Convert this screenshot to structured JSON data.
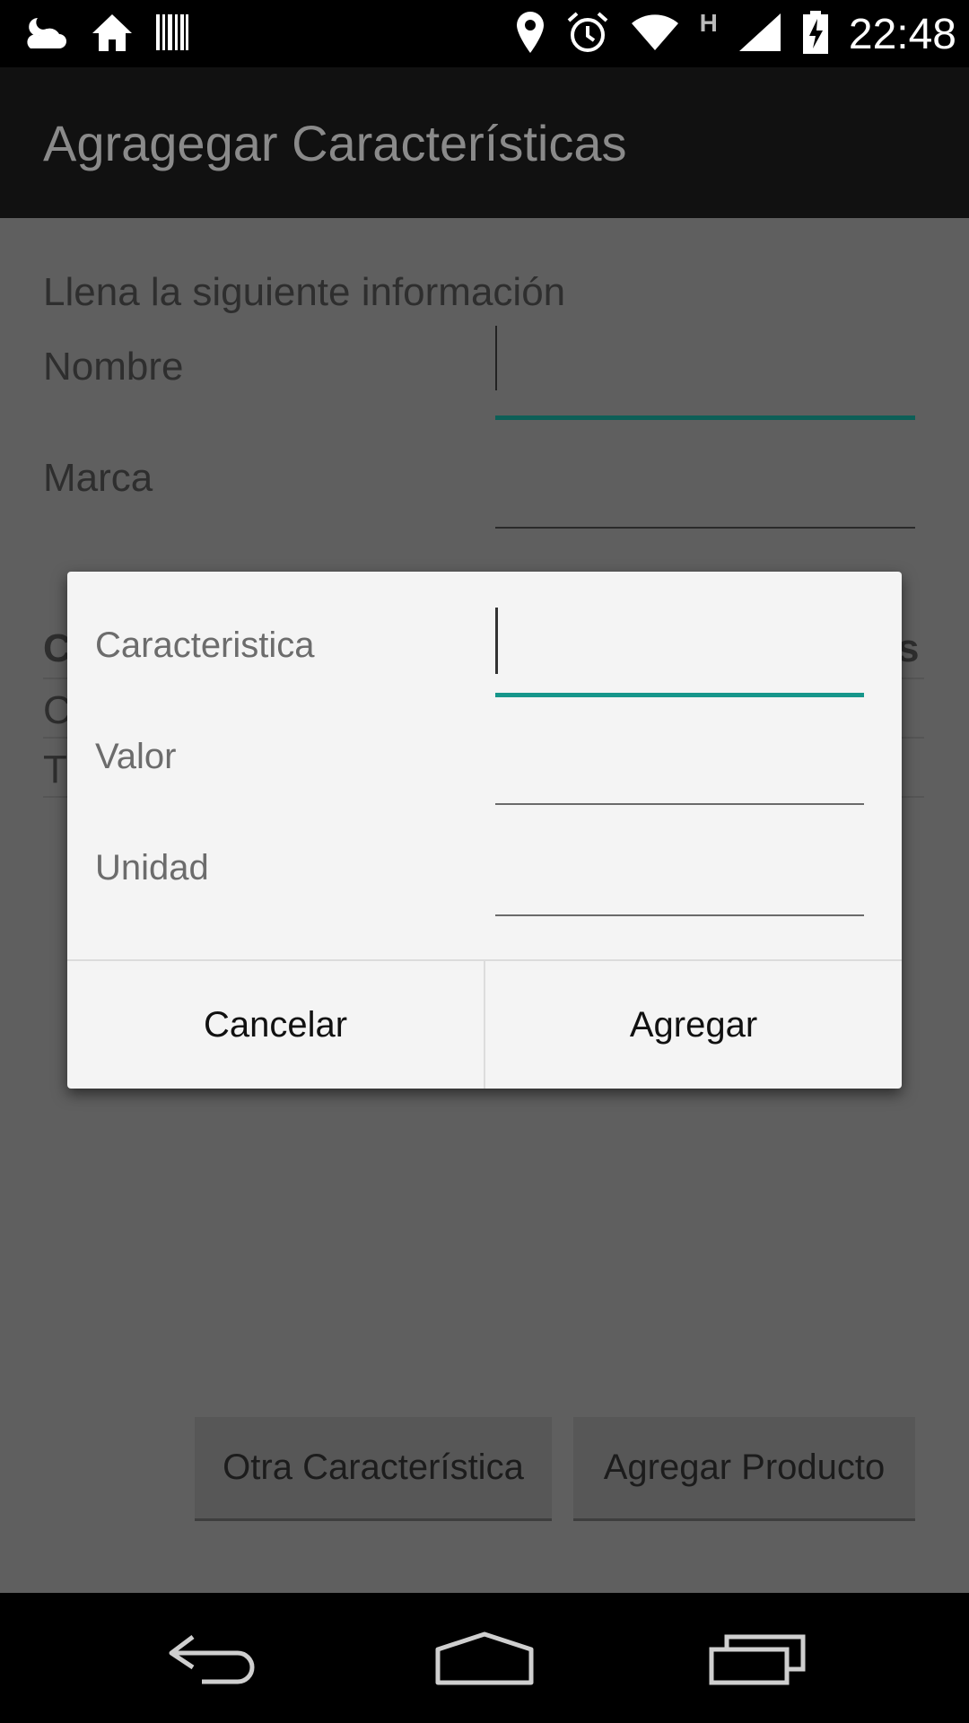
{
  "status_bar": {
    "time": "22:48",
    "network_type": "H",
    "icons_left": [
      "weather-cloudy-night-icon",
      "home-icon",
      "barcode-icon"
    ],
    "icons_right": [
      "location-pin-icon",
      "alarm-icon",
      "wifi-icon",
      "signal-icon",
      "battery-charging-icon"
    ]
  },
  "app_bar": {
    "title": "Agragegar Características"
  },
  "form": {
    "heading": "Llena la siguiente información",
    "fields": [
      {
        "label": "Nombre",
        "value": ""
      },
      {
        "label": "Marca",
        "value": ""
      }
    ],
    "table_fragments": [
      "C",
      "s",
      "C",
      "T"
    ]
  },
  "bottom_buttons": {
    "other_feature": "Otra Característica",
    "add_product": "Agregar Producto"
  },
  "dialog": {
    "fields": [
      {
        "label": "Caracteristica",
        "value": ""
      },
      {
        "label": "Valor",
        "value": ""
      },
      {
        "label": "Unidad",
        "value": ""
      }
    ],
    "cancel_label": "Cancelar",
    "confirm_label": "Agregar"
  },
  "nav_bar": {
    "icons": [
      "back-icon",
      "home-nav-icon",
      "recent-apps-icon"
    ]
  },
  "colors": {
    "status_bar_bg": "#000000",
    "app_bar_bg": "#111111",
    "scrim_bg": "#5f5f5f",
    "dialog_bg": "#f4f4f4",
    "accent_focus": "#16968a"
  }
}
